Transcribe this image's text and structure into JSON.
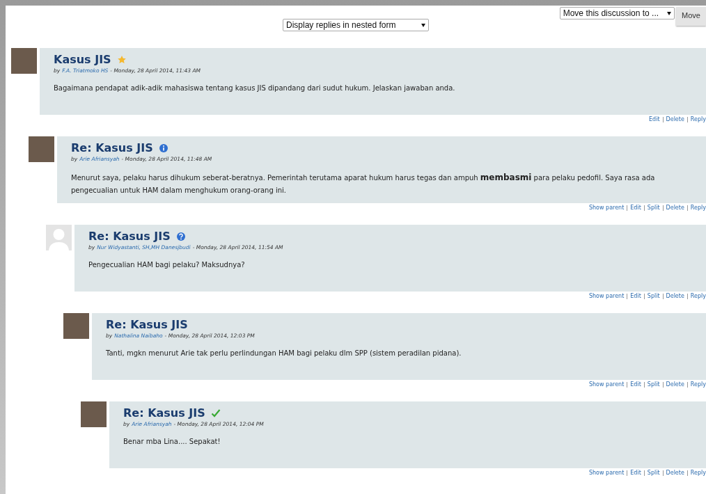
{
  "controls": {
    "display_mode": "Display replies in nested form",
    "move_select": "Move this discussion to ...",
    "move_button": "Move"
  },
  "posts": [
    {
      "subject": "Kasus JIS",
      "kind": "star",
      "avatar": {
        "kind": "photo"
      },
      "by": "by",
      "author": "F.A. Triatmoko HS",
      "date": "- Monday, 28 April 2014, 11:43 AM",
      "message": "Bagaimana pendapat adik-adik mahasiswa tentang kasus JIS dipandang dari sudut hukum. Jelaskan jawaban anda.",
      "actions": [
        "Edit",
        "Delete",
        "Reply"
      ],
      "children": [
        {
          "subject": "Re: Kasus JIS",
          "kind": "info",
          "avatar": {
            "kind": "photo"
          },
          "by": "by",
          "author": "Arie Afriansyah",
          "date": "- Monday, 28 April 2014, 11:48 AM",
          "message": "Menurut saya, pelaku harus dihukum seberat-beratnya. Pemerintah terutama aparat hukum harus tegas dan ampuh **membasmi** para pelaku pedofil. Saya rasa ada pengecualian untuk HAM dalam menghukum orang-orang ini.",
          "actions": [
            "Show parent",
            "Edit",
            "Split",
            "Delete",
            "Reply"
          ],
          "children": [
            {
              "subject": "Re: Kasus JIS",
              "kind": "question",
              "avatar": {
                "kind": "silhouette"
              },
              "by": "by",
              "author": "Nur Widyastanti, SH,MH Danesjbudi",
              "date": "- Monday, 28 April 2014, 11:54 AM",
              "message": "Pengecualian HAM bagi pelaku? Maksudnya?",
              "actions": [
                "Show parent",
                "Edit",
                "Split",
                "Delete",
                "Reply"
              ],
              "children": [
                {
                  "subject": "Re: Kasus JIS",
                  "avatar": {
                    "kind": "photo"
                  },
                  "by": "by",
                  "author": "Nathalina Naibaho",
                  "date": "- Monday, 28 April 2014, 12:03 PM",
                  "message": "Tanti, mgkn menurut Arie tak perlu perlindungan HAM bagi pelaku dlm SPP (sistem peradilan pidana).",
                  "actions": [
                    "Show parent",
                    "Edit",
                    "Split",
                    "Delete",
                    "Reply"
                  ],
                  "children": [
                    {
                      "subject": "Re: Kasus JIS",
                      "kind": "check",
                      "avatar": {
                        "kind": "photo"
                      },
                      "by": "by",
                      "author": "Arie Afriansyah",
                      "date": "- Monday, 28 April 2014, 12:04 PM",
                      "message": "Benar mba Lina.... Sepakat!",
                      "actions": [
                        "Show parent",
                        "Edit",
                        "Split",
                        "Delete",
                        "Reply"
                      ]
                    }
                  ]
                }
              ]
            }
          ]
        }
      ]
    }
  ]
}
